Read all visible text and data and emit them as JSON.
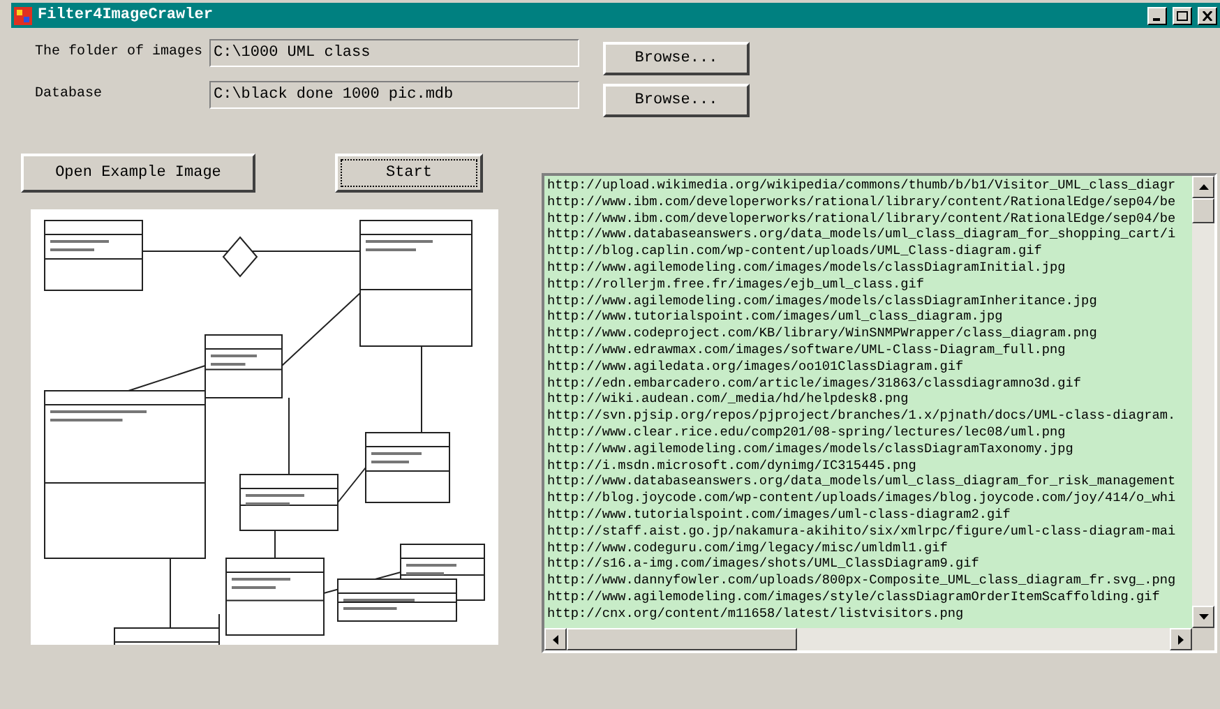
{
  "window": {
    "title": "Filter4ImageCrawler"
  },
  "fields": [
    {
      "label": "The folder of images",
      "value": "C:\\1000 UML class",
      "button": "Browse..."
    },
    {
      "label": "Database",
      "value": "C:\\black done 1000 pic.mdb",
      "button": "Browse..."
    }
  ],
  "buttons": [
    {
      "label": "Open Example Image",
      "selected": false
    },
    {
      "label": "Start",
      "selected": true
    }
  ],
  "url_list": [
    "http://upload.wikimedia.org/wikipedia/commons/thumb/b/b1/Visitor_UML_class_diagr",
    "http://www.ibm.com/developerworks/rational/library/content/RationalEdge/sep04/be",
    "http://www.ibm.com/developerworks/rational/library/content/RationalEdge/sep04/be",
    "http://www.databaseanswers.org/data_models/uml_class_diagram_for_shopping_cart/i",
    "http://blog.caplin.com/wp-content/uploads/UML_Class-diagram.gif",
    "http://www.agilemodeling.com/images/models/classDiagramInitial.jpg",
    "http://rollerjm.free.fr/images/ejb_uml_class.gif",
    "http://www.agilemodeling.com/images/models/classDiagramInheritance.jpg",
    "http://www.tutorialspoint.com/images/uml_class_diagram.jpg",
    "http://www.codeproject.com/KB/library/WinSNMPWrapper/class_diagram.png",
    "http://www.edrawmax.com/images/software/UML-Class-Diagram_full.png",
    "http://www.agiledata.org/images/oo101ClassDiagram.gif",
    "http://edn.embarcadero.com/article/images/31863/classdiagramno3d.gif",
    "http://wiki.audean.com/_media/hd/helpdesk8.png",
    "http://svn.pjsip.org/repos/pjproject/branches/1.x/pjnath/docs/UML-class-diagram.",
    "http://www.clear.rice.edu/comp201/08-spring/lectures/lec08/uml.png",
    "http://www.agilemodeling.com/images/models/classDiagramTaxonomy.jpg",
    "http://i.msdn.microsoft.com/dynimg/IC315445.png",
    "http://www.databaseanswers.org/data_models/uml_class_diagram_for_risk_management",
    "http://blog.joycode.com/wp-content/uploads/images/blog.joycode.com/joy/414/o_whi",
    "http://www.tutorialspoint.com/images/uml-class-diagram2.gif",
    "http://staff.aist.go.jp/nakamura-akihito/six/xmlrpc/figure/uml-class-diagram-mai",
    "http://www.codeguru.com/img/legacy/misc/umldml1.gif",
    "http://s16.a-img.com/images/shots/UML_ClassDiagram9.gif",
    "http://www.dannyfowler.com/uploads/800px-Composite_UML_class_diagram_fr.svg_.png",
    "http://www.agilemodeling.com/images/style/classDiagramOrderItemScaffolding.gif",
    "http://cnx.org/content/m11658/latest/listvisitors.png"
  ]
}
